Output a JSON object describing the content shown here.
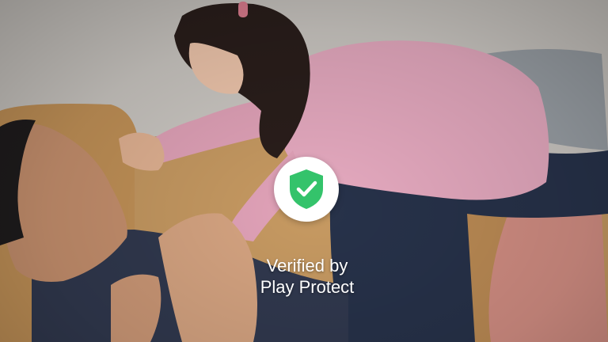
{
  "overlay": {
    "line1": "Verified by",
    "line2": "Play Protect",
    "shield_icon": "shield-check-icon",
    "shield_color": "#34c36b",
    "check_color": "#ffffff",
    "badge_color": "#ffffff"
  },
  "photo": {
    "subject": "father-and-daughter-playing-on-sofa-image"
  }
}
